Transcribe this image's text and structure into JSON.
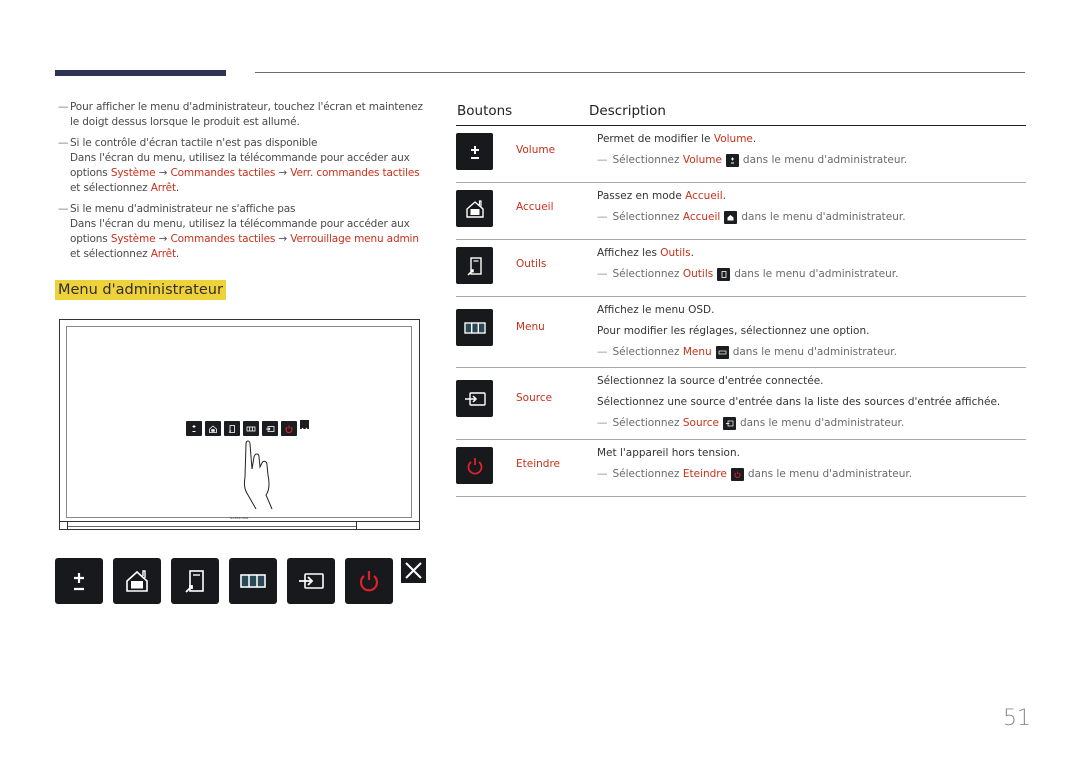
{
  "notes": [
    {
      "lines": [
        {
          "text": "Pour afficher le menu d'administrateur, touchez l'écran et maintenez le doigt dessus lorsque le produit est allumé."
        }
      ]
    },
    {
      "title": "Si le contrôle d'écran tactile n'est pas disponible",
      "body_prefix": "Dans l'écran du menu, utilisez la télécommande pour accéder aux options ",
      "path": [
        "Système",
        "Commandes tactiles",
        "Verr. commandes tactiles"
      ],
      "body_mid": " et sélectionnez ",
      "value": "Arrêt",
      "body_suffix": "."
    },
    {
      "title": "Si le menu d'administrateur ne s'affiche pas",
      "body_prefix": "Dans l'écran du menu, utilisez la télécommande pour accéder aux options ",
      "path": [
        "Système",
        "Commandes tactiles",
        "Verrouillage menu admin"
      ],
      "body_mid": " et sélectionnez ",
      "value": "Arrêt",
      "body_suffix": "."
    }
  ],
  "section_title": "Menu d'administrateur",
  "monitor": {
    "brand": "SAMSUNG"
  },
  "admin_menu_buttons": [
    {
      "name": "Volume",
      "icon": "volume-plus-minus-icon"
    },
    {
      "name": "Accueil",
      "icon": "home-icon"
    },
    {
      "name": "Outils",
      "icon": "tools-icon"
    },
    {
      "name": "Menu",
      "icon": "menu-grid-icon"
    },
    {
      "name": "Source",
      "icon": "source-input-icon"
    },
    {
      "name": "Eteindre",
      "icon": "power-icon",
      "color": "#e0202a"
    },
    {
      "name": "Fermer",
      "icon": "close-icon"
    }
  ],
  "table": {
    "headers": {
      "buttons": "Boutons",
      "description": "Description"
    },
    "select_prefix": "Sélectionnez",
    "select_suffix": "dans le menu d'administrateur.",
    "rows": [
      {
        "name": "Volume",
        "icon": "volume-plus-minus-icon",
        "desc_lines": [
          {
            "pre": "Permet de modifier le ",
            "hl": "Volume",
            "post": "."
          }
        ]
      },
      {
        "name": "Accueil",
        "icon": "home-icon",
        "desc_lines": [
          {
            "pre": "Passez en mode ",
            "hl": "Accueil",
            "post": "."
          }
        ]
      },
      {
        "name": "Outils",
        "icon": "tools-icon",
        "desc_lines": [
          {
            "pre": "Affichez les ",
            "hl": "Outils",
            "post": "."
          }
        ]
      },
      {
        "name": "Menu",
        "icon": "menu-grid-icon",
        "desc_lines": [
          {
            "pre": "Affichez le menu OSD.",
            "hl": "",
            "post": ""
          },
          {
            "pre": "Pour modifier les réglages, sélectionnez une option.",
            "hl": "",
            "post": ""
          }
        ]
      },
      {
        "name": "Source",
        "icon": "source-input-icon",
        "desc_lines": [
          {
            "pre": "Sélectionnez la source d'entrée connectée.",
            "hl": "",
            "post": ""
          },
          {
            "pre": "Sélectionnez une source d'entrée dans la liste des sources d'entrée affichée.",
            "hl": "",
            "post": ""
          }
        ]
      },
      {
        "name": "Eteindre",
        "icon": "power-icon",
        "desc_lines": [
          {
            "pre": "Met l'appareil hors tension.",
            "hl": "",
            "post": ""
          }
        ]
      }
    ]
  },
  "colors": {
    "highlight": "#c8311a",
    "title_bg": "#efd23a",
    "accent_bar": "#2d3350",
    "power_red": "#e0202a"
  },
  "page_number": "51"
}
